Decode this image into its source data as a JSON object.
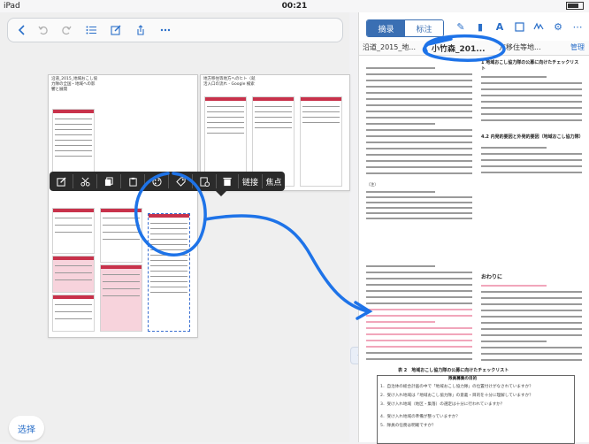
{
  "status": {
    "device": "iPad",
    "time": "00:21"
  },
  "left_toolbar": {
    "icons": [
      "chevron-left-icon",
      "undo-icon",
      "redo-icon",
      "list-icon",
      "edit-icon",
      "share-icon",
      "more-icon"
    ]
  },
  "cards": [
    {
      "title": "沿道_2015_地域おこし協力隊の全国・地域への影響と展開"
    },
    {
      "title": "地方移住等地方へのヒト（就活入口の流れ - Google 検索"
    }
  ],
  "context_menu": {
    "link_label": "链接",
    "focus_label": "焦点"
  },
  "select_button": "选择",
  "splitter_label": "‹ ›",
  "right_toolbar": {
    "segment": [
      "摘录",
      "标注"
    ],
    "manage": "管理"
  },
  "doc_tabs": {
    "tab1": "沿道_2015_地...",
    "tab2": "小竹森_201...",
    "tab3": "方移住等地...",
    "manage": "管理"
  },
  "doc": {
    "top_heading1": "1 地域おこし協力隊の公募に向けたチェックリスト",
    "top_heading2": "4.2 内発的要因と外発的要因（地域おこし協力隊）",
    "footnote": "（注）",
    "bottom_right_heading": "おわりに",
    "table_caption": "表 2　地域おこし協力隊の公募に向けたチェックリスト",
    "table_sub": "隊員募集の目的",
    "table_rows": [
      "1．自治体の総合計画の中で「地域おこし協力隊」の位置付けがなされていますか？",
      "2．受け入れ地域は「地域おこし協力隊」の意義・目的を十分に理解していますか？",
      "3．受け入れ地域（地区・集落）の選定は十分に行われていますか？",
      "4．受け入れ地域の準備が整っていますか？",
      "5．隊員の任務は明確ですか？"
    ]
  }
}
